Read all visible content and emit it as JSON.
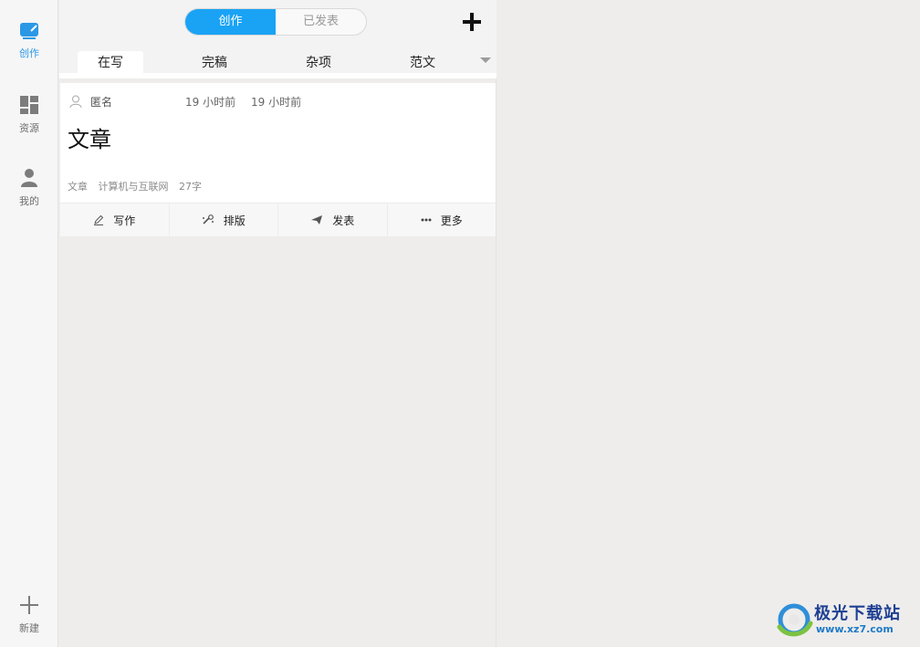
{
  "nav": {
    "items": [
      {
        "label": "创作",
        "icon": "compose-icon",
        "active": true
      },
      {
        "label": "资源",
        "icon": "dashboard-icon",
        "active": false
      },
      {
        "label": "我的",
        "icon": "user-icon",
        "active": false
      }
    ],
    "new": {
      "label": "新建",
      "icon": "plus-icon"
    }
  },
  "header": {
    "segments": [
      "创作",
      "已发表"
    ],
    "active_segment": "创作",
    "add_icon": "plus-icon"
  },
  "tabs": {
    "items": [
      "在写",
      "完稿",
      "杂项",
      "范文"
    ],
    "active": "在写",
    "more_icon": "caret-down-icon"
  },
  "card": {
    "author": "匿名",
    "created": "19 小时前",
    "modified": "19 小时前",
    "title": "文章",
    "meta": {
      "type": "文章",
      "category": "计算机与互联网",
      "word_count": "27字"
    },
    "actions": [
      {
        "label": "写作",
        "icon": "pen-icon"
      },
      {
        "label": "排版",
        "icon": "layout-icon"
      },
      {
        "label": "发表",
        "icon": "send-icon"
      },
      {
        "label": "更多",
        "icon": "more-icon"
      }
    ]
  },
  "watermark": {
    "title": "极光下载站",
    "url": "www.xz7.com"
  },
  "colors": {
    "accent": "#1aa3f5",
    "nav_active": "#2b98e6",
    "background": "#eeedeb"
  }
}
